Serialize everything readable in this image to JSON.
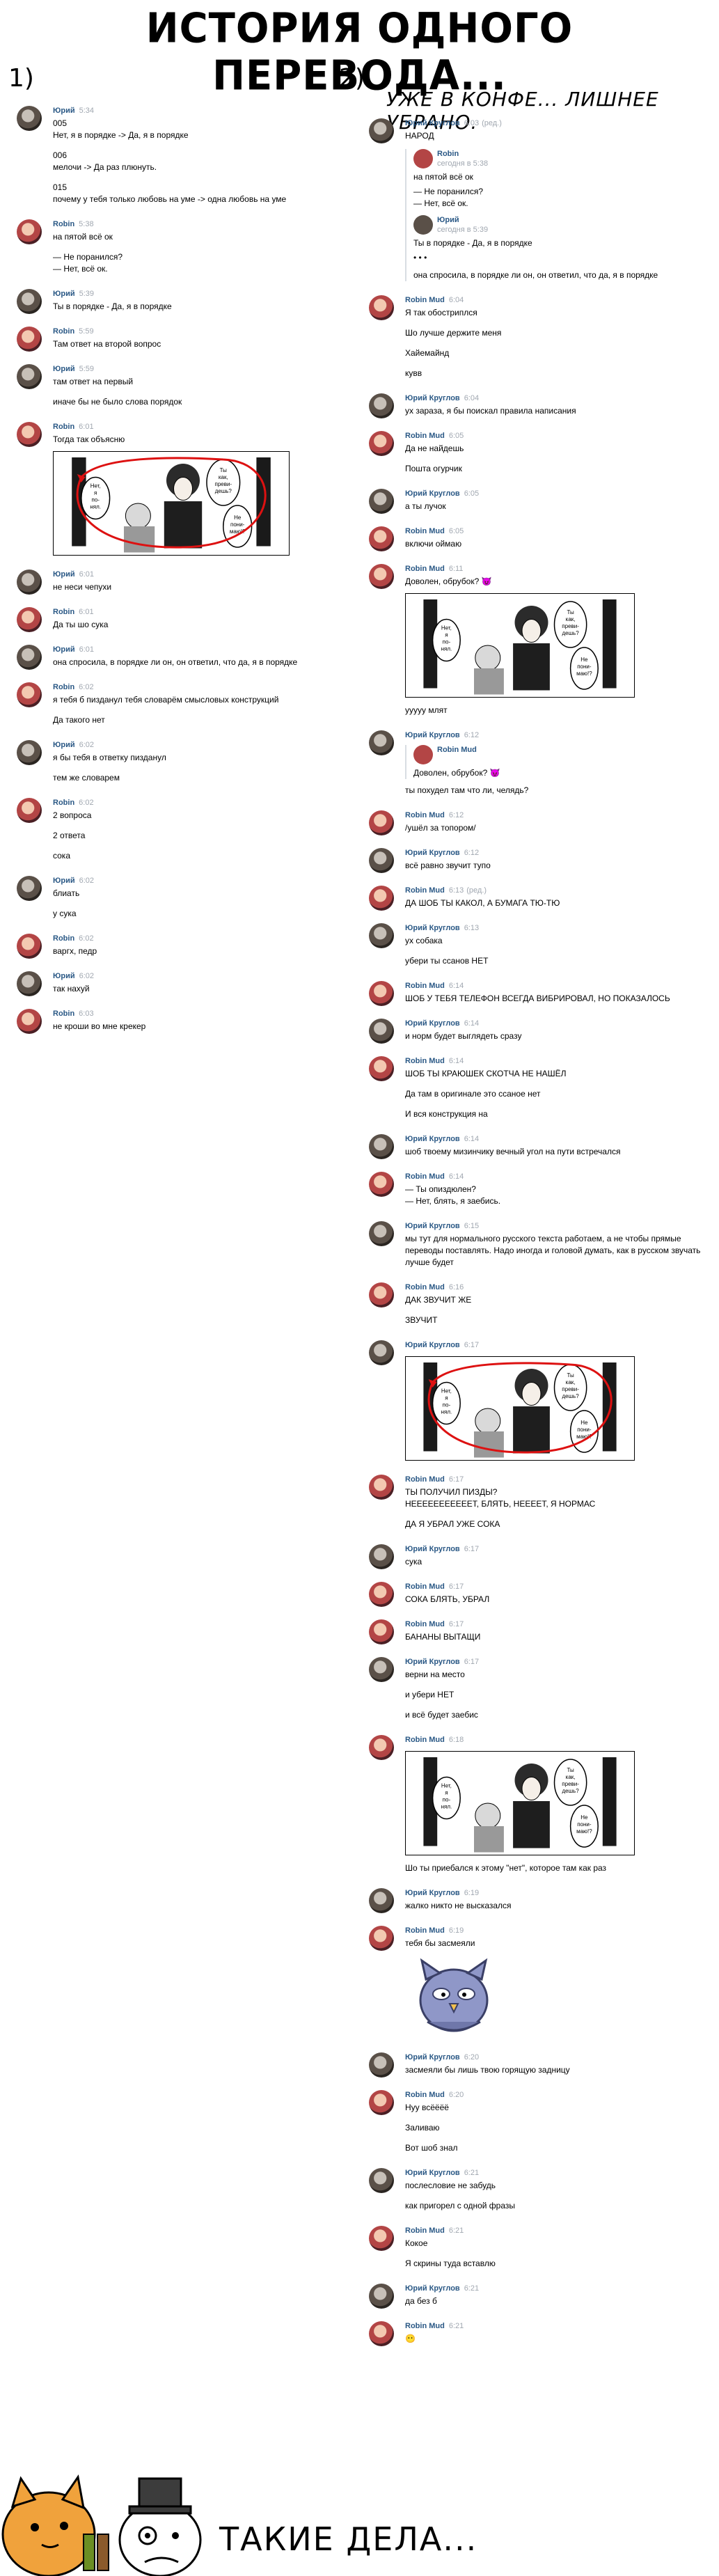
{
  "header": {
    "title": "ИСТОРИЯ ОДНОГО ПЕРЕВОДА...",
    "col1_num": "1)",
    "col2_num": "2)",
    "col2_subtitle": "УЖЕ В КОНФЕ... ЛИШНЕЕ УБРАНО."
  },
  "manga_text": {
    "bubble1": "Ты в порядке?",
    "bubble2": "Ты как, преви- дешь?",
    "bubble3": "Не пони- маю!?",
    "bubble4": "Нет, я по- нял."
  },
  "footer": {
    "text": "ТАКИЕ ДЕЛА..."
  },
  "col1": [
    {
      "name": "Юрий",
      "time": "5:34",
      "avatar": "yu",
      "lines": [
        "005\nНет, я в порядке -> Да, я в порядке",
        "006\nмелочи -> Да раз плюнуть.",
        "015\nпочему у тебя только любовь на уме -> одна любовь на уме"
      ]
    },
    {
      "name": "Robin",
      "time": "5:38",
      "avatar": "ro",
      "lines": [
        "на пятой всё ок",
        "— Не поранился?\n— Нет, всё ок."
      ]
    },
    {
      "name": "Юрий",
      "time": "5:39",
      "avatar": "yu",
      "lines": [
        "Ты в порядке - Да, я в порядке"
      ]
    },
    {
      "name": "Robin",
      "time": "5:59",
      "avatar": "ro",
      "lines": [
        "Там ответ на второй вопрос"
      ]
    },
    {
      "name": "Юрий",
      "time": "5:59",
      "avatar": "yu",
      "lines": [
        "там ответ на первый",
        "иначе бы не было слова порядок"
      ]
    },
    {
      "name": "Robin",
      "time": "6:01",
      "avatar": "ro",
      "lines": [
        "Тогда так объясню"
      ],
      "image": true
    },
    {
      "name": "Юрий",
      "time": "6:01",
      "avatar": "yu",
      "lines": [
        "не неси чепухи"
      ]
    },
    {
      "name": "Robin",
      "time": "6:01",
      "avatar": "ro",
      "lines": [
        "Да ты шо сука"
      ]
    },
    {
      "name": "Юрий",
      "time": "6:01",
      "avatar": "yu",
      "lines": [
        "она спросила, в порядке ли он, он ответил, что да, я в порядке"
      ]
    },
    {
      "name": "Robin",
      "time": "6:02",
      "avatar": "ro",
      "lines": [
        "я тебя б пизданул тебя словарём смысловых конструкций",
        "Да такого нет"
      ]
    },
    {
      "name": "Юрий",
      "time": "6:02",
      "avatar": "yu",
      "lines": [
        "я бы тебя в ответку пизданул",
        "тем же словарем"
      ]
    },
    {
      "name": "Robin",
      "time": "6:02",
      "avatar": "ro",
      "lines": [
        "2 вопроса",
        "2 ответа",
        "сока"
      ]
    },
    {
      "name": "Юрий",
      "time": "6:02",
      "avatar": "yu",
      "lines": [
        "блиать",
        "у сука"
      ]
    },
    {
      "name": "Robin",
      "time": "6:02",
      "avatar": "ro",
      "lines": [
        "варгх, педр"
      ]
    },
    {
      "name": "Юрий",
      "time": "6:02",
      "avatar": "yu",
      "lines": [
        "так нахуй"
      ]
    },
    {
      "name": "Robin",
      "time": "6:03",
      "avatar": "ro",
      "lines": [
        "не кроши во мне крекер"
      ]
    }
  ],
  "col2": [
    {
      "name": "Юрий Круглов",
      "time": "6:03",
      "avatar": "yu",
      "edited": "ред.",
      "lines": [
        "НАРОД"
      ],
      "quotes": [
        {
          "name": "Robin",
          "time": "сегодня в 5:38",
          "lines": [
            "на пятой всё ок",
            "— Не поранился?\n— Нет, всё ок."
          ]
        },
        {
          "name": "Юрий",
          "time": "сегодня в 5:39",
          "lines": [
            "Ты в порядке - Да, я в порядке",
            "• • •"
          ]
        }
      ],
      "after": "она спросила, в порядке ли он, он ответил, что да, я в порядке"
    },
    {
      "name": "Robin Mud",
      "time": "6:04",
      "avatar": "ro",
      "lines": [
        "Я так обостриплся",
        "Шо лучше держите меня",
        "Хайемайнд",
        "кувв"
      ]
    },
    {
      "name": "Юрий Круглов",
      "time": "6:04",
      "avatar": "yu",
      "lines": [
        "ух зараза, я бы поискал правила написания"
      ]
    },
    {
      "name": "Robin Mud",
      "time": "6:05",
      "avatar": "ro",
      "lines": [
        "Да не найдешь",
        "Пошта огурчик"
      ]
    },
    {
      "name": "Юрий Круглов",
      "time": "6:05",
      "avatar": "yu",
      "lines": [
        "а ты лучок"
      ]
    },
    {
      "name": "Robin Mud",
      "time": "6:05",
      "avatar": "ro",
      "lines": [
        "включи оймаю"
      ]
    },
    {
      "name": "Robin Mud",
      "time": "6:11",
      "avatar": "ro",
      "lines": [
        "Доволен, обрубок? 😈"
      ],
      "image": true,
      "after": "ууууу млят"
    },
    {
      "name": "Юрий Круглов",
      "time": "6:12",
      "avatar": "yu",
      "lines": [
        "ты похудел там что ли, челядь?"
      ],
      "quotes": [
        {
          "name": "Robin Mud",
          "time": "",
          "lines": [
            "Доволен, обрубок? 😈"
          ]
        }
      ]
    },
    {
      "name": "Robin Mud",
      "time": "6:12",
      "avatar": "ro",
      "lines": [
        "/ушёл за топором/"
      ]
    },
    {
      "name": "Юрий Круглов",
      "time": "6:12",
      "avatar": "yu",
      "lines": [
        "всё равно звучит тупо"
      ]
    },
    {
      "name": "Robin Mud",
      "time": "6:13",
      "avatar": "ro",
      "edited": "ред.",
      "lines": [
        "ДА ШОБ ТЫ КАКОЛ, А БУМАГА ТЮ-ТЮ"
      ]
    },
    {
      "name": "Юрий Круглов",
      "time": "6:13",
      "avatar": "yu",
      "lines": [
        "ух собака",
        "убери ты ссанов НЕТ"
      ]
    },
    {
      "name": "Robin Mud",
      "time": "6:14",
      "avatar": "ro",
      "lines": [
        "ШОБ У ТЕБЯ ТЕЛЕФОН ВСЕГДА ВИБРИРОВАЛ, НО ПОКАЗАЛОСЬ"
      ]
    },
    {
      "name": "Юрий Круглов",
      "time": "6:14",
      "avatar": "yu",
      "lines": [
        "и норм будет выглядеть сразу"
      ]
    },
    {
      "name": "Robin Mud",
      "time": "6:14",
      "avatar": "ro",
      "lines": [
        "ШОБ ТЫ КРАЮШЕК СКОТЧА НЕ НАШЁЛ",
        "Да там в оригинале это ссаное нет",
        "И вся конструкция на"
      ]
    },
    {
      "name": "Юрий Круглов",
      "time": "6:14",
      "avatar": "yu",
      "lines": [
        "шоб твоему мизинчику вечный угол на пути встречался"
      ]
    },
    {
      "name": "Robin Mud",
      "time": "6:14",
      "avatar": "ro",
      "lines": [
        "— Ты опиздюлен?\n— Нет, блять, я заебись."
      ]
    },
    {
      "name": "Юрий Круглов",
      "time": "6:15",
      "avatar": "yu",
      "lines": [
        "мы тут для нормального русского текста работаем, а не чтобы прямые переводы поставлять. Надо иногда и головой думать, как в русском звучать лучше будет"
      ]
    },
    {
      "name": "Robin Mud",
      "time": "6:16",
      "avatar": "ro",
      "lines": [
        "ДАК ЗВУЧИТ ЖЕ",
        "ЗВУЧИТ"
      ]
    },
    {
      "name": "Юрий Круглов",
      "time": "6:17",
      "avatar": "yu",
      "lines": [],
      "image": true
    },
    {
      "name": "Robin Mud",
      "time": "6:17",
      "avatar": "ro",
      "lines": [
        "ТЫ ПОЛУЧИЛ ПИЗДЫ?\nНЕЕЕЕЕЕЕЕЕЕЕТ, БЛЯТЬ, НЕЕЕЕТ, Я НОРМАС",
        "ДА Я УБРАЛ УЖЕ СОКА"
      ]
    },
    {
      "name": "Юрий Круглов",
      "time": "6:17",
      "avatar": "yu",
      "lines": [
        "сука"
      ]
    },
    {
      "name": "Robin Mud",
      "time": "6:17",
      "avatar": "ro",
      "lines": [
        "СОКА БЛЯТЬ, УБРАЛ"
      ]
    },
    {
      "name": "Robin Mud",
      "time": "6:17",
      "avatar": "ro",
      "lines": [
        "БАНАНЫ ВЫТАЩИ"
      ]
    },
    {
      "name": "Юрий Круглов",
      "time": "6:17",
      "avatar": "yu",
      "lines": [
        "верни на место",
        "и убери НЕТ",
        "и всё будет заебис"
      ]
    },
    {
      "name": "Robin Mud",
      "time": "6:18",
      "avatar": "ro",
      "lines": [],
      "image": true,
      "after": "Шо ты приебался к этому \"нет\", которое там как раз"
    },
    {
      "name": "Юрий Круглов",
      "time": "6:19",
      "avatar": "yu",
      "lines": [
        "жалко никто не высказался"
      ]
    },
    {
      "name": "Robin Mud",
      "time": "6:19",
      "avatar": "ro",
      "lines": [
        "тебя бы засмеяли"
      ],
      "sticker": true
    },
    {
      "name": "Юрий Круглов",
      "time": "6:20",
      "avatar": "yu",
      "lines": [
        "засмеяли бы лишь твою горящую задницу"
      ]
    },
    {
      "name": "Robin Mud",
      "time": "6:20",
      "avatar": "ro",
      "lines": [
        "Нуу всёёёё",
        "Заливаю",
        "Вот шоб знал"
      ]
    },
    {
      "name": "Юрий Круглов",
      "time": "6:21",
      "avatar": "yu",
      "lines": [
        "послесловие не забудь",
        "как пригорел с одной фразы"
      ]
    },
    {
      "name": "Robin Mud",
      "time": "6:21",
      "avatar": "ro",
      "lines": [
        "Кокое",
        "Я скрины туда вставлю"
      ]
    },
    {
      "name": "Юрий Круглов",
      "time": "6:21",
      "avatar": "yu",
      "lines": [
        "да без б"
      ]
    },
    {
      "name": "Robin Mud",
      "time": "6:21",
      "avatar": "ro",
      "lines": [
        "😶"
      ]
    }
  ]
}
